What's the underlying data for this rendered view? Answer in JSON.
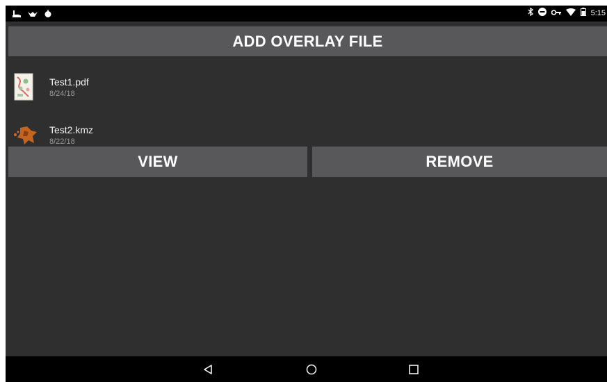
{
  "status_bar": {
    "left_icons": [
      "download-icon",
      "notification-icon",
      "app-icon"
    ],
    "right_icons": [
      "bluetooth-icon",
      "do-not-disturb-icon",
      "vpn-key-icon",
      "wifi-icon",
      "battery-icon"
    ],
    "time": "5:15"
  },
  "add_button": {
    "label": "ADD OVERLAY FILE"
  },
  "files": [
    {
      "name": "Test1.pdf",
      "date": "8/24/18",
      "icon": "pdf-thumbnail"
    },
    {
      "name": "Test2.kmz",
      "date": "8/22/18",
      "icon": "kmz-map-icon"
    }
  ],
  "actions": {
    "view_label": "VIEW",
    "remove_label": "REMOVE"
  },
  "nav_bar": {
    "icons": [
      "back-icon",
      "home-icon",
      "recents-icon"
    ]
  },
  "colors": {
    "background": "#2f2f2f",
    "button": "#58585b",
    "bars": "#000000",
    "text_primary": "#f2f2f2",
    "text_secondary": "#9a9a9a"
  }
}
